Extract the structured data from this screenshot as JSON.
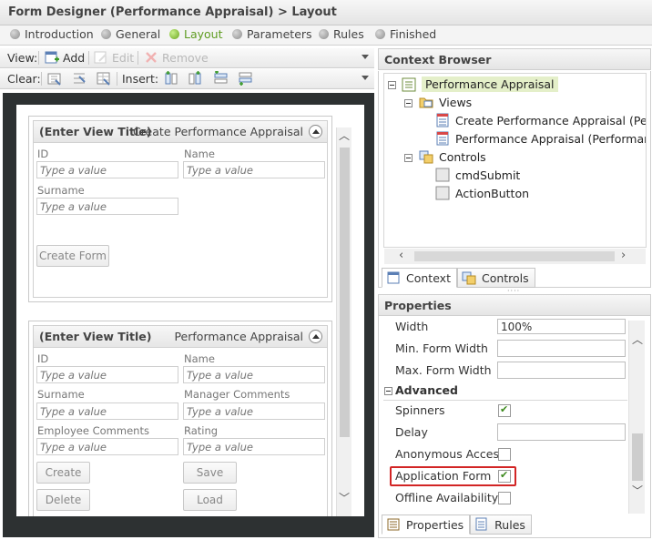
{
  "window": {
    "title": "Form Designer (Performance Appraisal) > Layout"
  },
  "steps": [
    {
      "label": "Introduction",
      "active": false
    },
    {
      "label": "General",
      "active": false
    },
    {
      "label": "Layout",
      "active": true
    },
    {
      "label": "Parameters",
      "active": false
    },
    {
      "label": "Rules",
      "active": false
    },
    {
      "label": "Finished",
      "active": false
    }
  ],
  "toolbar_view": {
    "label": "View:",
    "add": "Add",
    "edit": "Edit",
    "remove": "Remove"
  },
  "toolbar_clear": {
    "clear_label": "Clear:",
    "insert_label": "Insert:"
  },
  "view1": {
    "title": "(Enter View Title)",
    "name": "Create Performance Appraisal",
    "fields": {
      "id": "ID",
      "name": "Name",
      "surname": "Surname"
    },
    "placeholder": "Type a value",
    "button": "Create Form"
  },
  "view2": {
    "title": "(Enter View Title)",
    "name": "Performance Appraisal",
    "fields": {
      "id": "ID",
      "name": "Name",
      "surname": "Surname",
      "manager_comments": "Manager Comments",
      "employee_comments": "Employee Comments",
      "rating": "Rating"
    },
    "placeholder": "Type a value",
    "buttons": {
      "create": "Create",
      "save": "Save",
      "delete": "Delete",
      "load": "Load"
    }
  },
  "context_browser": {
    "title": "Context Browser",
    "root": "Performance Appraisal",
    "views_label": "Views",
    "views": [
      "Create Performance Appraisal (Perfor",
      "Performance Appraisal (Performance"
    ],
    "controls_label": "Controls",
    "controls": [
      "cmdSubmit",
      "ActionButton"
    ],
    "tabs": [
      "Context",
      "Controls"
    ]
  },
  "properties": {
    "title": "Properties",
    "width_label": "Width",
    "width_value": "100%",
    "min_width_label": "Min. Form Width",
    "max_width_label": "Max. Form Width",
    "advanced_label": "Advanced",
    "spinners_label": "Spinners",
    "spinners_checked": true,
    "delay_label": "Delay",
    "anonymous_label": "Anonymous Access",
    "anonymous_checked": false,
    "app_form_label": "Application Form",
    "app_form_checked": true,
    "offline_label": "Offline Availability",
    "offline_checked": false,
    "tabs": [
      "Properties",
      "Rules"
    ]
  },
  "colors": {
    "active_step": "#6aa51e",
    "highlight": "#d22525",
    "selected_node": "#e4efc9"
  }
}
